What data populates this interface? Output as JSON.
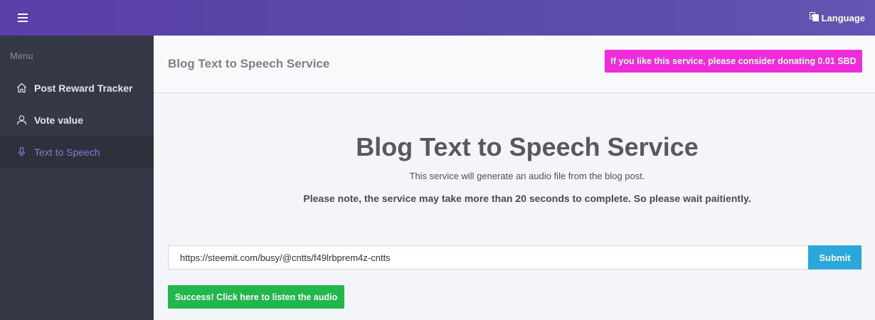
{
  "topbar": {
    "menu_icon": "hamburger-icon",
    "language_icon": "translate-icon",
    "language_label": "Language"
  },
  "sidebar": {
    "menu_title": "Menu",
    "items": [
      {
        "label": "Post Reward Tracker",
        "icon": "home-icon",
        "active": false
      },
      {
        "label": "Vote value",
        "icon": "user-icon",
        "active": false
      },
      {
        "label": "Text to Speech",
        "icon": "microphone-icon",
        "active": true
      }
    ]
  },
  "header": {
    "title": "Blog Text to Speech Service",
    "donate_label": "If you like this service, please consider donating 0.01 SBD"
  },
  "main": {
    "title": "Blog Text to Speech Service",
    "subtitle": "This service will generate an audio file from the blog post.",
    "note": "Please note, the service may take more than 20 seconds to complete. So please wait paitiently.",
    "url_value": "https://steemit.com/busy/@cntts/f49lrbprem4z-cntts",
    "submit_label": "Submit",
    "success_label": "Success! Click here to listen the audio"
  },
  "colors": {
    "topbar": "#5a3fa8",
    "sidebar": "#353846",
    "active_nav": "#8c78d6",
    "donate": "#f02bdc",
    "submit": "#2aa7db",
    "success": "#20b84b"
  }
}
